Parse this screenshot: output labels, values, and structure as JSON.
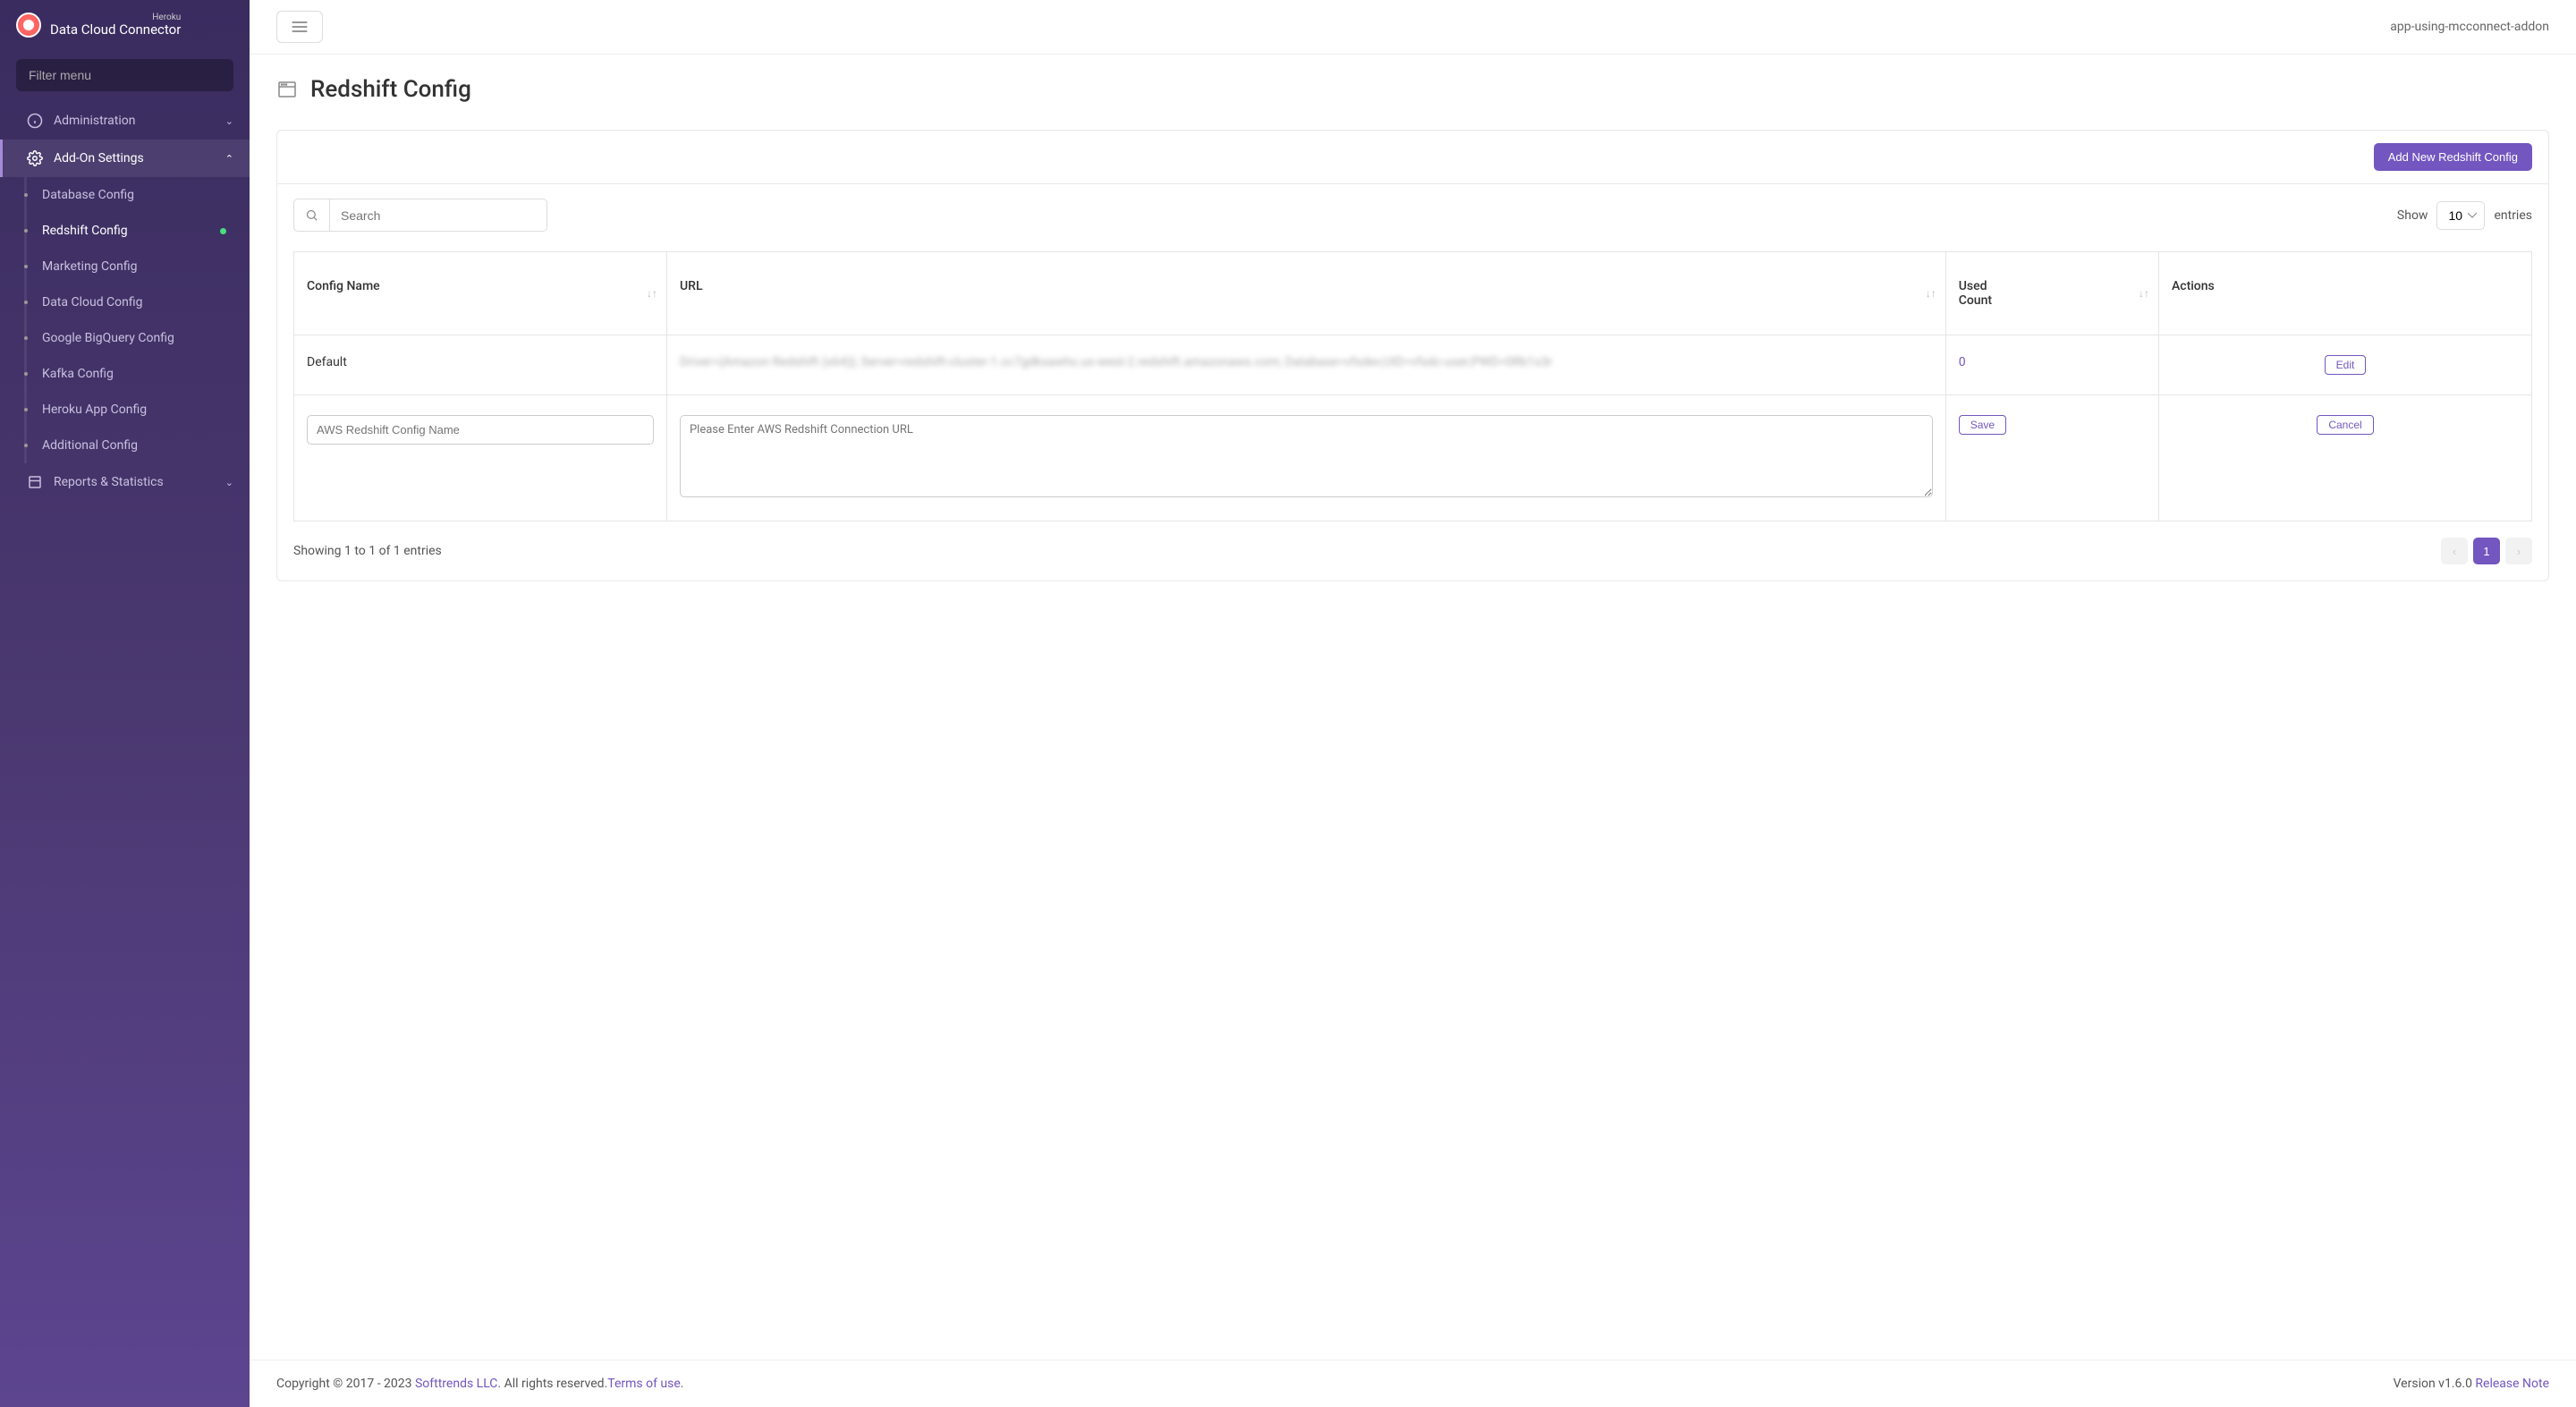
{
  "brand": {
    "top": "Heroku",
    "main": "Data Cloud Connector"
  },
  "sidebar": {
    "filter_placeholder": "Filter menu",
    "sections": {
      "administration": "Administration",
      "addon_settings": "Add-On Settings",
      "reports": "Reports & Statistics"
    },
    "settings_items": [
      "Database Config",
      "Redshift Config",
      "Marketing Config",
      "Data Cloud Config",
      "Google BigQuery Config",
      "Kafka Config",
      "Heroku App Config",
      "Additional Config"
    ]
  },
  "topbar": {
    "app_name": "app-using-mcconnect-addon"
  },
  "page": {
    "title": "Redshift Config"
  },
  "panel": {
    "add_button": "Add New Redshift Config",
    "search_placeholder": "Search",
    "show_label": "Show",
    "show_value": "10",
    "entries_label": "entries",
    "columns": {
      "name": "Config Name",
      "url": "URL",
      "count": "Used\nCount",
      "actions": "Actions"
    },
    "rows": [
      {
        "name": "Default",
        "url": "Driver={Amazon Redshift (x64)}; Server=redshift-cluster-1.cc7gdkxawhs.us-west-2.redshift.amazonaws.com; Database=vfsdev;UID=vfsdc-user;PWD=0Rb1s3r",
        "count": "0",
        "action": "Edit"
      }
    ],
    "new_row": {
      "name_placeholder": "AWS Redshift Config Name",
      "url_placeholder": "Please Enter AWS Redshift Connection URL",
      "save": "Save",
      "cancel": "Cancel"
    },
    "footer_info": "Showing 1 to 1 of 1 entries",
    "page_current": "1"
  },
  "footer": {
    "copyright_prefix": "Copyright © 2017 - 2023 ",
    "company": "Softtrends LLC",
    "rights": ". All rights reserved.",
    "terms": "Terms of use",
    "period": ".",
    "version": "Version v1.6.0  ",
    "release": "Release Note"
  }
}
